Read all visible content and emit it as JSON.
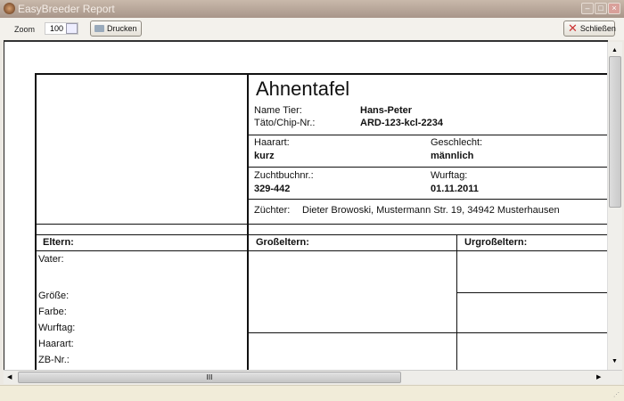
{
  "window": {
    "title": "EasyBreeder Report",
    "min": "–",
    "max": "□",
    "close": "×"
  },
  "toolbar": {
    "zoom_label": "Zoom",
    "zoom_value": "100",
    "print_label": "Drucken",
    "close_label": "Schließen"
  },
  "report": {
    "title": "Ahnentafel",
    "name_label": "Name Tier:",
    "name_value": "Hans-Peter",
    "chip_label": "Täto/Chip-Nr.:",
    "chip_value": "ARD-123-kcl-2234",
    "hair_label": "Haarart:",
    "hair_value": "kurz",
    "sex_label": "Geschlecht:",
    "sex_value": "männlich",
    "studbook_label": "Zuchtbuchnr.:",
    "studbook_value": "329-442",
    "birth_label": "Wurftag:",
    "birth_value": "01.11.2011",
    "breeder_label": "Züchter:",
    "breeder_value": "Dieter Browoski, Mustermann Str. 19, 34942 Musterhausen",
    "col_parents": "Eltern:",
    "col_grandparents": "Großeltern:",
    "col_greatgrandparents": "Urgroßeltern:",
    "father_label": "Vater:",
    "size_label": "Größe:",
    "color_label": "Farbe:",
    "f_birth_label": "Wurftag:",
    "f_hair_label": "Haarart:",
    "f_zb_label": "ZB-Nr.:"
  },
  "scroll": {
    "thumb": "III"
  }
}
